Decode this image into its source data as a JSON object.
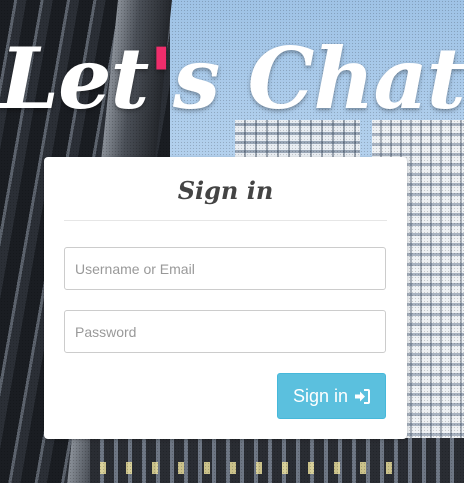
{
  "logo": {
    "part1": "Let",
    "apostrophe": "'",
    "part2": "s Chat",
    "accent_color": "#ef2d6b"
  },
  "signin": {
    "title": "Sign in",
    "username": {
      "value": "",
      "placeholder": "Username or Email"
    },
    "password": {
      "value": "",
      "placeholder": "Password"
    },
    "submit_label": "Sign in",
    "submit_icon": "sign-in-icon",
    "button_color": "#5bc0de"
  }
}
